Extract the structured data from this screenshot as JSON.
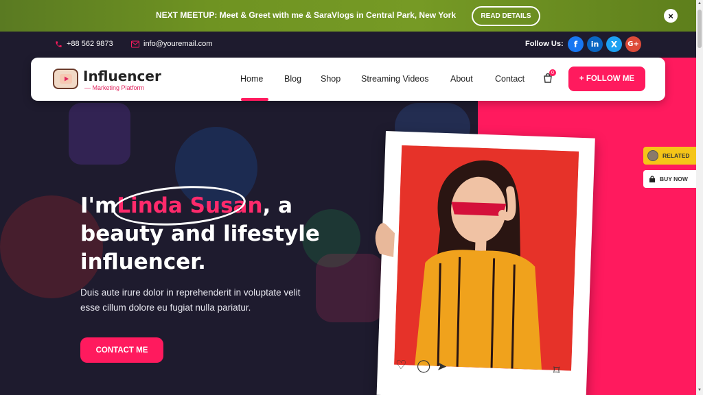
{
  "announcement": {
    "text": "NEXT MEETUP: Meet & Greet with me & SaraVlogs in Central Park, New York",
    "button": "READ DETAILS",
    "close_icon": "×"
  },
  "infobar": {
    "phone": "+88 562 9873",
    "email": "info@youremail.com",
    "follow_label": "Follow Us:",
    "socials": [
      {
        "name": "facebook",
        "glyph": "f",
        "color": "#1877f2"
      },
      {
        "name": "linkedin",
        "glyph": "in",
        "color": "#0a66c2"
      },
      {
        "name": "x",
        "glyph": "X",
        "color": "#1da1f2"
      },
      {
        "name": "google-plus",
        "glyph": "G+",
        "color": "#dd4b39"
      }
    ]
  },
  "nav": {
    "logo_title": "Influencer",
    "logo_sub": "— Marketing Platform",
    "links": [
      "Home",
      "Blog",
      "Shop",
      "Streaming Videos",
      "About",
      "Contact"
    ],
    "active": "Home",
    "cart_count": "0",
    "follow_button": "+ FOLLOW ME"
  },
  "hero": {
    "line1_prefix": "I'm",
    "name": "Linda Susan",
    "line1_suffix": ", a",
    "line2": "beauty and lifestyle",
    "line3": "influencer.",
    "desc": "Duis aute irure dolor in reprehenderit in voluptate velit esse cillum dolore eu fugiat nulla pariatur.",
    "contact_button": "CONTACT ME"
  },
  "side": {
    "related": "RELATED",
    "buy_now": "BUY NOW"
  },
  "colors": {
    "accent": "#ff1a5e",
    "dark_bg": "#1e1b2e",
    "announce_bg": "#6f9322"
  }
}
